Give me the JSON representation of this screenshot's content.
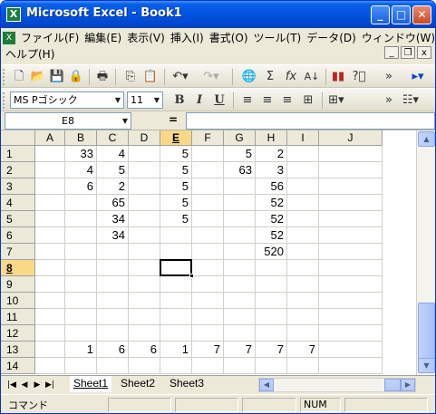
{
  "window": {
    "title": "Microsoft Excel - Book1",
    "app_icon": "X",
    "minimize": "_",
    "maximize": "□",
    "close": "✕"
  },
  "menu": {
    "items": [
      "ファイル(F)",
      "編集(E)",
      "表示(V)",
      "挿入(I)",
      "書式(O)",
      "ツール(T)",
      "データ(D)",
      "ウィンドウ(W)",
      "ヘルプ(H)"
    ],
    "doc_minimize": "_",
    "doc_restore": "❐",
    "doc_close": "x"
  },
  "toolbar": {
    "font_name": "MS Pゴシック",
    "font_size": "11",
    "bold": "B",
    "italic": "I",
    "underline": "U"
  },
  "formula_bar": {
    "name_box": "E8",
    "equals": "=",
    "formula": ""
  },
  "columns": [
    "A",
    "B",
    "C",
    "D",
    "E",
    "F",
    "G",
    "H",
    "I",
    "J"
  ],
  "rows": [
    "1",
    "2",
    "3",
    "4",
    "5",
    "6",
    "7",
    "8",
    "9",
    "10",
    "11",
    "12",
    "13",
    "14"
  ],
  "active_cell": {
    "col": "E",
    "row": "8"
  },
  "cells": [
    [
      "",
      "33",
      "4",
      "",
      "5",
      "",
      "5",
      "2",
      "",
      ""
    ],
    [
      "",
      "4",
      "5",
      "",
      "5",
      "",
      "63",
      "3",
      "",
      ""
    ],
    [
      "",
      "6",
      "2",
      "",
      "5",
      "",
      "",
      "56",
      "",
      ""
    ],
    [
      "",
      "",
      "65",
      "",
      "5",
      "",
      "",
      "52",
      "",
      ""
    ],
    [
      "",
      "",
      "34",
      "",
      "5",
      "",
      "",
      "52",
      "",
      ""
    ],
    [
      "",
      "",
      "34",
      "",
      "",
      "",
      "",
      "52",
      "",
      ""
    ],
    [
      "",
      "",
      "",
      "",
      "",
      "",
      "",
      "520",
      "",
      ""
    ],
    [
      "",
      "",
      "",
      "",
      "",
      "",
      "",
      "",
      "",
      ""
    ],
    [
      "",
      "",
      "",
      "",
      "",
      "",
      "",
      "",
      "",
      ""
    ],
    [
      "",
      "",
      "",
      "",
      "",
      "",
      "",
      "",
      "",
      ""
    ],
    [
      "",
      "",
      "",
      "",
      "",
      "",
      "",
      "",
      "",
      ""
    ],
    [
      "",
      "",
      "",
      "",
      "",
      "",
      "",
      "",
      "",
      ""
    ],
    [
      "",
      "1",
      "6",
      "6",
      "1",
      "7",
      "7",
      "7",
      "7",
      ""
    ],
    [
      "",
      "",
      "",
      "",
      "",
      "",
      "",
      "",
      "",
      ""
    ]
  ],
  "sheets": [
    "Sheet1",
    "Sheet2",
    "Sheet3"
  ],
  "active_sheet": "Sheet1",
  "status": {
    "mode": "コマンド",
    "num": "NUM"
  }
}
